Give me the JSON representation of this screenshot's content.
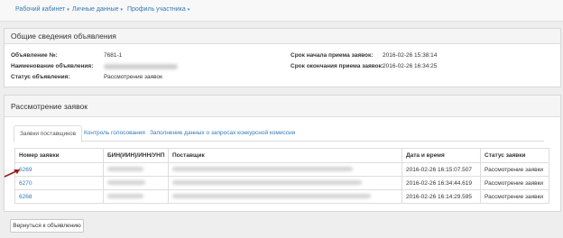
{
  "nav": {
    "items": [
      "Рабочий кабинет",
      "Личные данные",
      "Профиль участника"
    ],
    "caret": "▾"
  },
  "general": {
    "title": "Общие сведения объявления",
    "announcement_no_label": "Объявление №:",
    "announcement_no_value": "7681-1",
    "name_label": "Наименование объявления:",
    "status_label": "Статус объявления:",
    "status_value": "Рассмотрение заявок",
    "start_label": "Срок начала приема заявок:",
    "start_value": "2016-02-26 15:38:14",
    "end_label": "Срок окончания приема заявок:",
    "end_value": "2016-02-26 16:34:25"
  },
  "review": {
    "title": "Рассмотрение заявок",
    "tabs": [
      {
        "label": "Заявки поставщиков",
        "active": true
      },
      {
        "label": "Контроль голосования",
        "active": false
      },
      {
        "label": "Заполнение данных о запросах конкурсной комиссии",
        "active": false
      }
    ],
    "table": {
      "headers": [
        "Номер заявки",
        "БИН(ИИН)/ИНН/УНП",
        "Поставщик",
        "Дата и время",
        "Статус заявки"
      ],
      "rows": [
        {
          "number": "6269",
          "datetime": "2016-02-26 16:15:07.507",
          "status": "Рассмотрение заявки"
        },
        {
          "number": "6270",
          "datetime": "2016-02-26 16:34:44.619",
          "status": "Рассмотрение заявки"
        },
        {
          "number": "6268",
          "datetime": "2016-02-26 16:14:29.595",
          "status": "Рассмотрение заявки"
        }
      ]
    }
  },
  "footer": {
    "back_button": "Вернуться к объявлению"
  },
  "colors": {
    "link": "#337ab7",
    "arrow": "#9c1b1b"
  }
}
